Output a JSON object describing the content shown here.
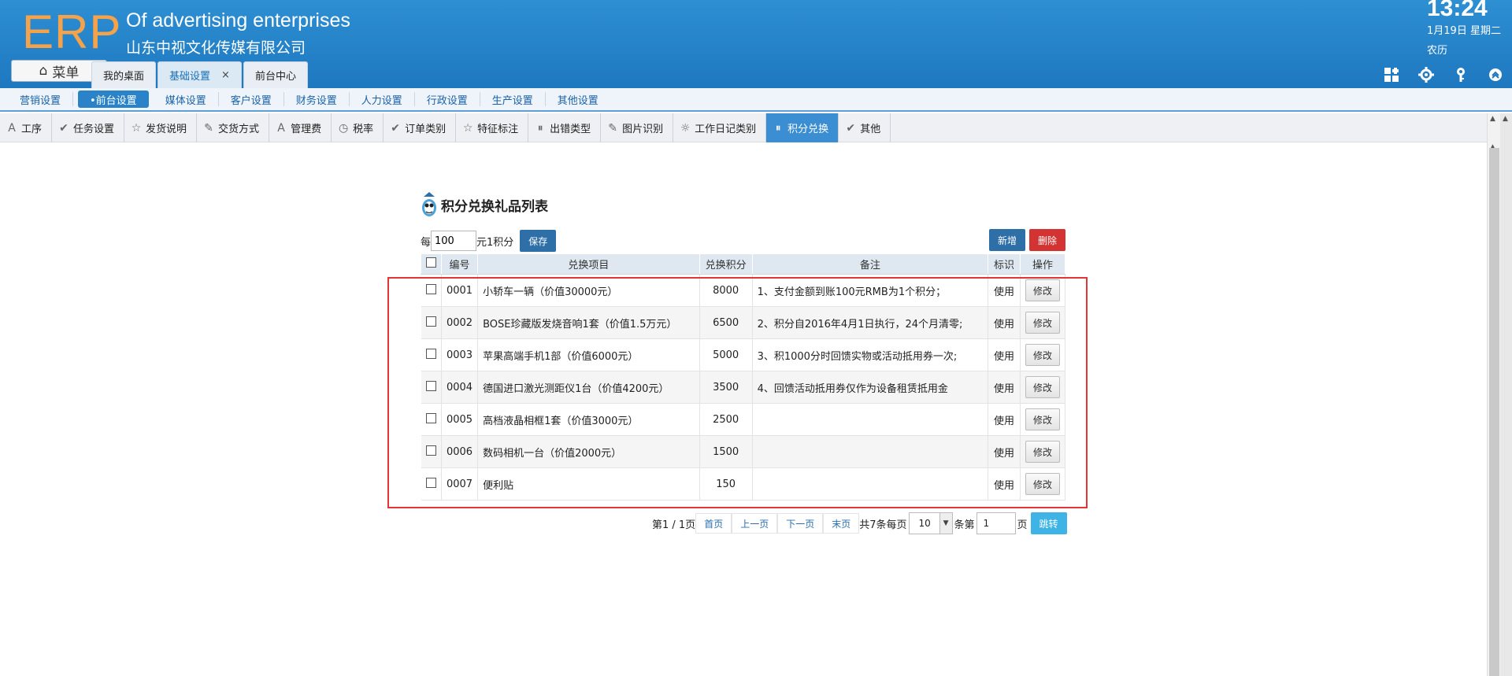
{
  "header": {
    "logo": "ERP",
    "company_en": "Of advertising enterprises",
    "company_cn": "山东中视文化传媒有限公司",
    "time": "13:24",
    "date": "1月19日 星期二",
    "lunar": "农历",
    "menu_label": "菜单",
    "tabs": [
      {
        "label": "我的桌面"
      },
      {
        "label": "基础设置",
        "close": "×"
      },
      {
        "label": "前台中心"
      }
    ]
  },
  "subnav": {
    "items": [
      "营销设置",
      "•前台设置",
      "媒体设置",
      "客户设置",
      "财务设置",
      "人力设置",
      "行政设置",
      "生产设置",
      "其他设置"
    ]
  },
  "toolbar": {
    "items": [
      "工序",
      "任务设置",
      "发货说明",
      "交货方式",
      "管理费",
      "税率",
      "订单类别",
      "特征标注",
      "出错类型",
      "图片识别",
      "工作日记类别",
      "积分兑换",
      "其他"
    ]
  },
  "content": {
    "title": "积分兑换礼品列表",
    "rate_prefix": "每",
    "rate_value": "100",
    "rate_suffix": "元1积分",
    "save_label": "保存",
    "new_label": "新增",
    "delete_label": "删除",
    "columns": [
      "编号",
      "兑换项目",
      "兑换积分",
      "备注",
      "标识",
      "操作"
    ],
    "edit_label": "修改",
    "rows": [
      {
        "no": "0001",
        "item": "小轿车一辆（价值30000元）",
        "points": "8000",
        "note": "1、支付金额到账100元RMB为1个积分；",
        "flag": "使用"
      },
      {
        "no": "0002",
        "item": "BOSE珍藏版发烧音响1套（价值1.5万元）",
        "points": "6500",
        "note": "2、积分自2016年4月1日执行，24个月清零;",
        "flag": "使用"
      },
      {
        "no": "0003",
        "item": "苹果高端手机1部（价值6000元）",
        "points": "5000",
        "note": "3、积1000分时回馈实物或活动抵用券一次;",
        "flag": "使用"
      },
      {
        "no": "0004",
        "item": "德国进口激光测距仪1台（价值4200元）",
        "points": "3500",
        "note": "4、回馈活动抵用券仅作为设备租赁抵用金",
        "flag": "使用"
      },
      {
        "no": "0005",
        "item": "高档液晶相框1套（价值3000元）",
        "points": "2500",
        "note": "",
        "flag": "使用"
      },
      {
        "no": "0006",
        "item": "数码相机一台（价值2000元）",
        "points": "1500",
        "note": "",
        "flag": "使用"
      },
      {
        "no": "0007",
        "item": "便利贴",
        "points": "150",
        "note": "",
        "flag": "使用"
      }
    ]
  },
  "pager": {
    "page_info": "第1 / 1页",
    "first": "首页",
    "prev": "上一页",
    "next": "下一页",
    "last": "末页",
    "total_text": "共7条每页",
    "page_size": "10",
    "per_unit": "条第",
    "page_input": "1",
    "page_suffix": "页",
    "jump_label": "跳转"
  },
  "colors": {
    "header_bg": "#2e8fd3",
    "logo": "#f5a34a",
    "active_tool": "#3b8ed2",
    "delete": "#d43333",
    "highlight": "#e23535"
  }
}
